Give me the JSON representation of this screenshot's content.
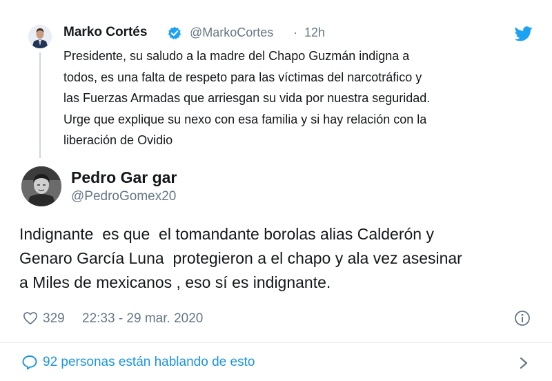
{
  "quoted_tweet": {
    "name": "Marko Cortés",
    "handle": "@MarkoCortes",
    "separator": "·",
    "time": "12h",
    "text": "Presidente, su saludo a la madre del Chapo Guzmán indigna a\ntodos, es una falta de respeto para las víctimas del narcotráfico y\nlas Fuerzas Armadas que arriesgan su vida por nuestra seguridad.\nUrge que explique su nexo con esa familia y si hay relación con la\nliberación de Ovidio",
    "verified": true
  },
  "reply_tweet": {
    "name": "Pedro Gar gar",
    "handle": "@PedroGomex20",
    "text": "Indignante  es que  el tomandante borolas alias Calderón y\nGenaro García Luna  protegieron a el chapo y ala vez asesinar\na Miles de mexicanos , eso sí es indignante.",
    "likes": "329",
    "timestamp": "22:33 - 29 mar. 2020"
  },
  "footer": {
    "talking_label": "92 personas están hablando de esto"
  },
  "colors": {
    "accent": "#1da1f2",
    "link": "#1b95e0",
    "muted": "#657786",
    "text": "#14171a"
  },
  "icons": [
    "twitter-bird-icon",
    "verified-badge-icon",
    "heart-icon",
    "info-icon",
    "speech-bubble-icon",
    "chevron-right-icon"
  ]
}
